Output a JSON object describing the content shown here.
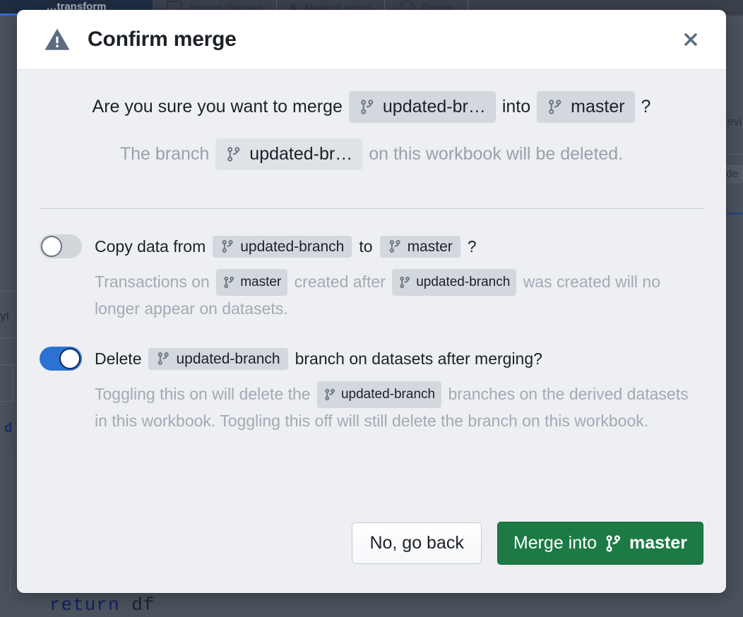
{
  "background": {
    "active_tab_label": "…transform",
    "toolbar_buttons": [
      {
        "label": "Import dataset",
        "icon": "import-dataset-icon"
      },
      {
        "label": "Manual entry",
        "icon": "play-icon"
      },
      {
        "label": "Delete",
        "icon": "shield-icon"
      }
    ],
    "right_panel": {
      "preview_text": "revi",
      "mode_chip": "ode"
    },
    "left_panel": {
      "python_label": "yt",
      "def_keyword": "d"
    },
    "code_line": {
      "keyword": "return",
      "identifier": "df"
    }
  },
  "modal": {
    "title": "Confirm merge",
    "warning_icon": "warning-triangle-icon",
    "close_icon": "close-icon",
    "branch_icon": "git-branch-icon",
    "question": {
      "prefix": "Are you sure you want to merge",
      "source_branch_truncated": "updated-br…",
      "middle": "into",
      "target_branch": "master",
      "suffix": "?"
    },
    "subtext": {
      "prefix": "The branch",
      "branch_truncated": "updated-br…",
      "suffix": "on this workbook will be deleted."
    },
    "options": [
      {
        "id": "copy-data",
        "enabled": false,
        "head": {
          "lead": "Copy data from",
          "source_branch": "updated-branch",
          "middle": "to",
          "target_branch": "master",
          "suffix": "?"
        },
        "description": {
          "part1": "Transactions on",
          "branch1": "master",
          "part2": "created after",
          "branch2": "updated-branch",
          "part3": "was created will no longer appear on datasets."
        }
      },
      {
        "id": "delete-branch",
        "enabled": true,
        "head": {
          "lead": "Delete",
          "source_branch": "updated-branch",
          "middle": "branch on datasets after merging?"
        },
        "description": {
          "part1": "Toggling this on will delete the",
          "branch1": "updated-branch",
          "part2": "branches on the derived datasets in this workbook. Toggling this off will still delete the branch on this workbook."
        }
      }
    ],
    "footer": {
      "cancel_label": "No, go back",
      "confirm_prefix": "Merge into",
      "confirm_branch": "master"
    }
  },
  "colors": {
    "modal_bg": "#edeff2",
    "header_bg": "#ffffff",
    "tag_bg": "#d3d8de",
    "toggle_on": "#2d72d2",
    "toggle_off": "#d2d6db",
    "primary_button": "#1d7a45",
    "title_text": "#1c2127",
    "muted_text": "#a2aab4"
  }
}
